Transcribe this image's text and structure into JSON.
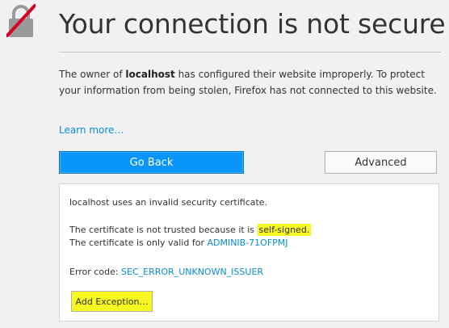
{
  "header": {
    "title": "Your connection is not secure",
    "icon": "broken-lock-icon",
    "icon_slash_color": "#d70022"
  },
  "description": {
    "part1": "The owner of ",
    "host": "localhost",
    "part2": " has configured their website improperly. To protect your information from being stolen, Firefox has not connected to this website."
  },
  "learn_more_label": "Learn more…",
  "buttons": {
    "go_back": "Go Back",
    "advanced": "Advanced",
    "add_exception": "Add Exception…"
  },
  "advanced_panel": {
    "line1": "localhost uses an invalid security certificate.",
    "line2_prefix": "The certificate is not trusted because it is ",
    "line2_highlight": "self-signed.",
    "line3_prefix": "The certificate is only valid for ",
    "line3_host": "ADMINIB-71OFPMJ",
    "error_prefix": "Error code: ",
    "error_code": "SEC_ERROR_UNKNOWN_ISSUER"
  },
  "colors": {
    "primary_button": "#0996f8",
    "link": "#0a8dd4",
    "highlight": "#f7f721",
    "background": "#f1f1f1"
  }
}
